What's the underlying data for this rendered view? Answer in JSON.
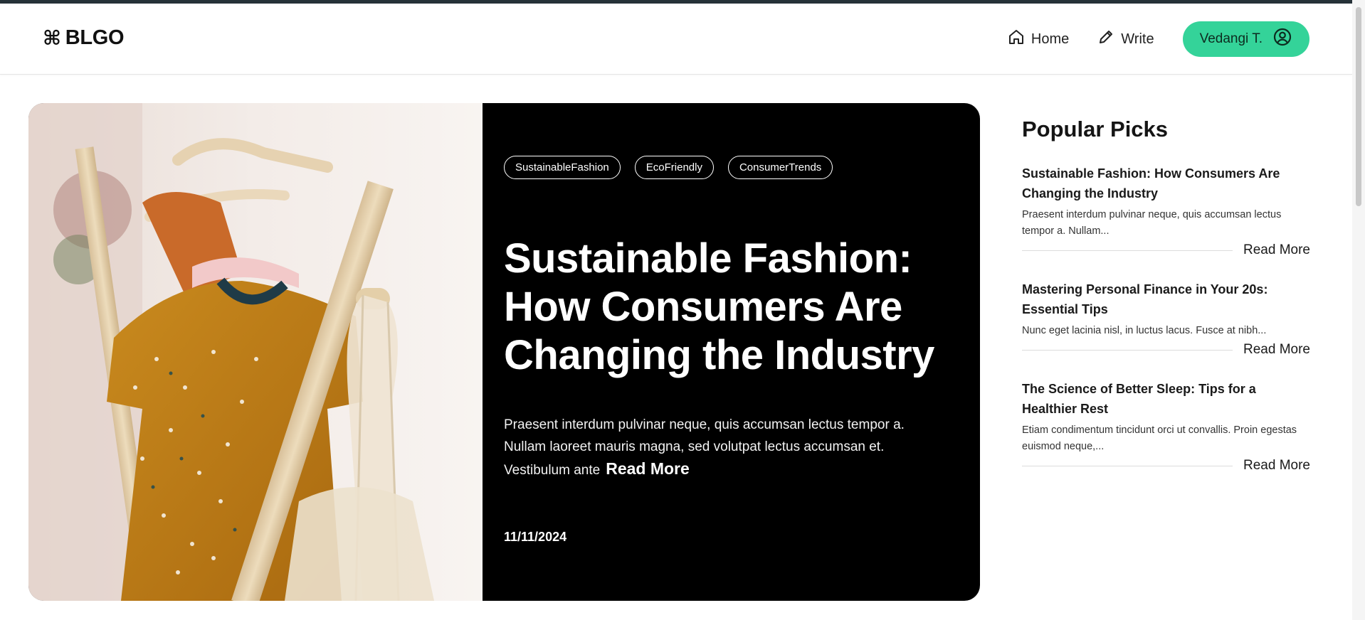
{
  "brand": {
    "logo_glyph": "⌘",
    "name": "BLGO"
  },
  "nav": {
    "home_label": "Home",
    "write_label": "Write",
    "user_name": "Vedangi T.",
    "accent_color": "#34d399"
  },
  "hero": {
    "tags": [
      "SustainableFashion",
      "EcoFriendly",
      "ConsumerTrends"
    ],
    "title": "Sustainable Fashion: How Consumers Are Changing the Industry",
    "excerpt": "Praesent interdum pulvinar neque, quis accumsan lectus tempor a. Nullam laoreet mauris magna, sed volutpat lectus accumsan et. Vestibulum ante",
    "read_more": "Read More",
    "date": "11/11/2024"
  },
  "sidebar": {
    "title": "Popular Picks",
    "picks": [
      {
        "title": "Sustainable Fashion: How Consumers Are Changing the Industry",
        "excerpt": "Praesent interdum pulvinar neque, quis accumsan lectus tempor a. Nullam...",
        "read_more": "Read More"
      },
      {
        "title": "Mastering Personal Finance in Your 20s: Essential Tips",
        "excerpt": "Nunc eget lacinia nisl, in luctus lacus. Fusce at nibh...",
        "read_more": "Read More"
      },
      {
        "title": "The Science of Better Sleep: Tips for a Healthier Rest",
        "excerpt": "Etiam condimentum tincidunt orci ut convallis. Proin egestas euismod neque,...",
        "read_more": "Read More"
      }
    ]
  }
}
